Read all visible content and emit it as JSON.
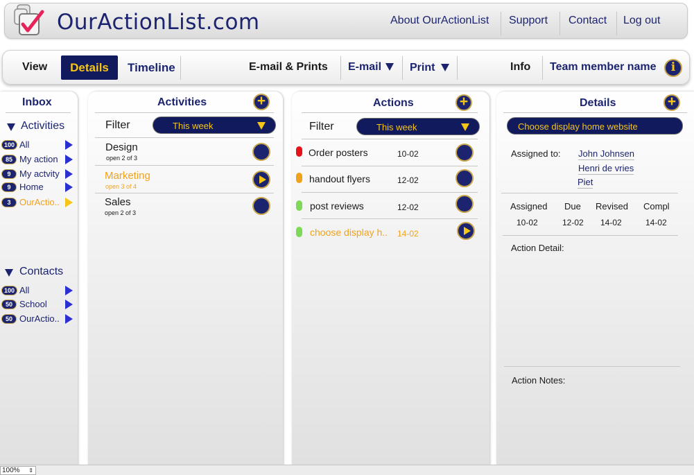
{
  "header": {
    "brand": "OurActionList.com",
    "links": [
      "About OurActionList",
      "Support",
      "Contact",
      "Log out"
    ]
  },
  "toolbar": {
    "view_label": "View",
    "details_label": "Details",
    "timeline_label": "Timeline",
    "email_prints_label": "E-mail & Prints",
    "email_label": "E-mail",
    "print_label": "Print",
    "info_label": "Info",
    "team_member": "Team member name",
    "info_icon_glyph": "i"
  },
  "inbox": {
    "title": "Inbox",
    "activities_head": "Activities",
    "activities": [
      {
        "count": "100",
        "label": "All"
      },
      {
        "count": "85",
        "label": "My action"
      },
      {
        "count": "9",
        "label": "My actvity"
      },
      {
        "count": "9",
        "label": "Home"
      },
      {
        "count": "3",
        "label": "OurActio.."
      }
    ],
    "contacts_head": "Contacts",
    "contacts": [
      {
        "count": "100",
        "label": "All"
      },
      {
        "count": "50",
        "label": "School"
      },
      {
        "count": "50",
        "label": "OurActio.."
      }
    ]
  },
  "activities_panel": {
    "title": "Activities",
    "filter_label": "Filter",
    "filter_value": "This week",
    "items": [
      {
        "name": "Design",
        "sub": "open 2 of 3"
      },
      {
        "name": "Marketing",
        "sub": "open 3 of 4"
      },
      {
        "name": "Sales",
        "sub": "open 2 of 3"
      }
    ]
  },
  "actions_panel": {
    "title": "Actions",
    "filter_label": "Filter",
    "filter_value": "This week",
    "items": [
      {
        "name": "Order posters",
        "date": "10-02",
        "status_color": "#e8101a"
      },
      {
        "name": "handout flyers",
        "date": "12-02",
        "status_color": "#f0a21c"
      },
      {
        "name": "post reviews",
        "date": "12-02",
        "status_color": "#7ed957"
      },
      {
        "name": "choose display h..",
        "date": "14-02",
        "status_color": "#7ed957"
      }
    ]
  },
  "details_panel": {
    "title": "Details",
    "selected": "Choose display home website",
    "assigned_to_label": "Assigned to:",
    "assignees": [
      "John Johnsen",
      "Henri de vries",
      "Piet"
    ],
    "columns": [
      "Assigned",
      "Due",
      "Revised",
      "Compl"
    ],
    "values": [
      "10-02",
      "12-02",
      "14-02",
      "14-02"
    ],
    "action_detail_label": "Action Detail:",
    "action_notes_label": "Action Notes:"
  },
  "statusbar": {
    "zoom": "100%"
  },
  "colors": {
    "navy": "#1c2470",
    "accent_yellow": "#f5c518",
    "highlight_orange": "#f0a21c"
  }
}
